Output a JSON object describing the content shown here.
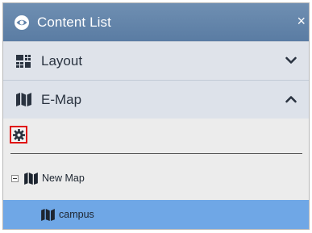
{
  "panel": {
    "title": "Content List",
    "close_glyph": "×"
  },
  "sections": {
    "layout": {
      "label": "Layout",
      "state": "collapsed",
      "icon": "layout-grid-icon"
    },
    "emap": {
      "label": "E-Map",
      "state": "expanded",
      "icon": "map-icon"
    }
  },
  "toolbar": {
    "settings_icon": "gear-icon",
    "highlighted": true,
    "highlight_color": "#e01010"
  },
  "tree": {
    "nodes": [
      {
        "label": "New Map",
        "expanded": true,
        "icon": "map-icon"
      },
      {
        "label": "campus",
        "selected": true,
        "icon": "map-icon"
      }
    ]
  },
  "colors": {
    "titlebar": "#5f81a8",
    "section_bg": "#dde2ea",
    "selected_row": "#6fa7e6"
  }
}
